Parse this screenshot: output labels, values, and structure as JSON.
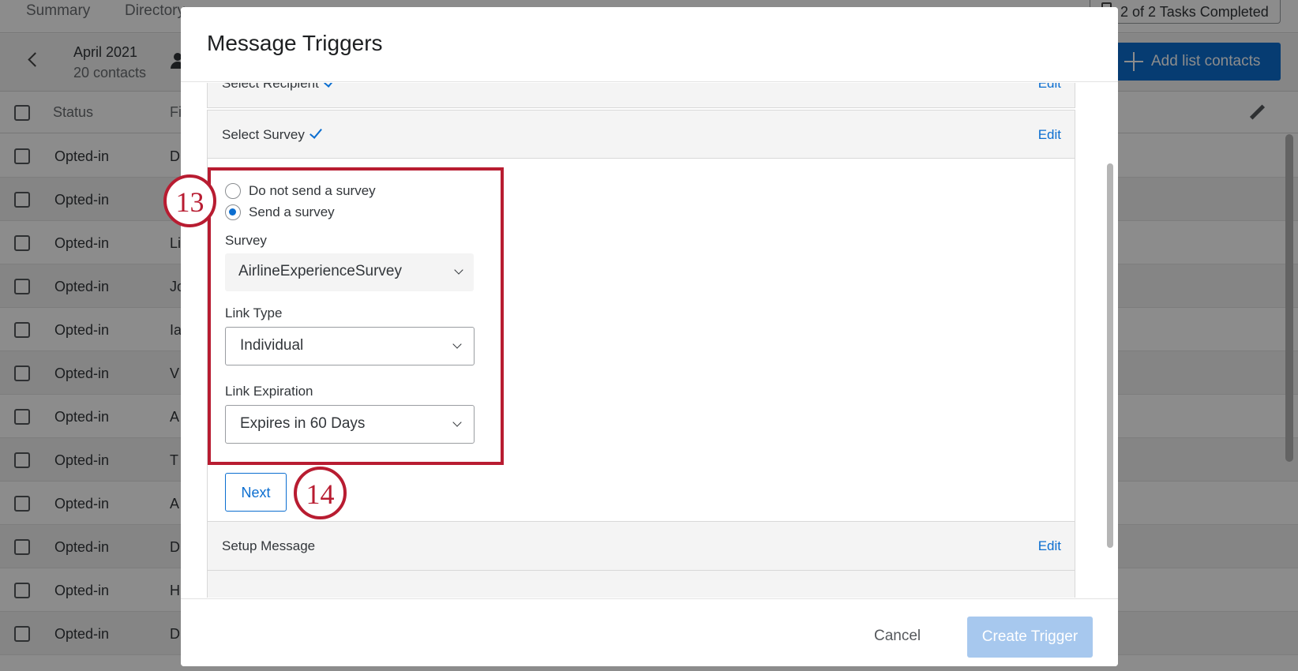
{
  "app": {
    "nav": [
      "Summary",
      "Directory"
    ],
    "tasks_label": "2 of 2 Tasks Completed",
    "list_name": "April 2021",
    "list_count": "20 contacts",
    "add_contacts_label": "Add list contacts",
    "columns": {
      "status": "Status",
      "first": "Fi"
    },
    "rows": [
      {
        "status": "Opted-in",
        "first": "D"
      },
      {
        "status": "Opted-in",
        "first": ""
      },
      {
        "status": "Opted-in",
        "first": "Li"
      },
      {
        "status": "Opted-in",
        "first": "Jo"
      },
      {
        "status": "Opted-in",
        "first": "Ia"
      },
      {
        "status": "Opted-in",
        "first": "V"
      },
      {
        "status": "Opted-in",
        "first": "A"
      },
      {
        "status": "Opted-in",
        "first": "T"
      },
      {
        "status": "Opted-in",
        "first": "A"
      },
      {
        "status": "Opted-in",
        "first": "D"
      },
      {
        "status": "Opted-in",
        "first": "H"
      },
      {
        "status": "Opted-in",
        "first": "D"
      }
    ]
  },
  "modal": {
    "title": "Message Triggers",
    "sections": {
      "recipient": {
        "label": "Select Recipient",
        "edit": "Edit"
      },
      "survey": {
        "label": "Select Survey",
        "edit": "Edit"
      },
      "message": {
        "label": "Setup Message",
        "edit": "Edit"
      }
    },
    "options": {
      "no_survey": "Do not send a survey",
      "send_survey": "Send a survey",
      "selected": "send_survey"
    },
    "fields": {
      "survey_label": "Survey",
      "survey_value": "AirlineExperienceSurvey",
      "link_type_label": "Link Type",
      "link_type_value": "Individual",
      "link_expiration_label": "Link Expiration",
      "link_expiration_value": "Expires in 60 Days"
    },
    "next_label": "Next",
    "cancel_label": "Cancel",
    "create_label": "Create Trigger"
  },
  "annotations": {
    "callout_13": "13",
    "callout_14": "14",
    "highlight_color": "#b81c31"
  },
  "colors": {
    "accent": "#0b6ed0",
    "disabled_button": "#a7c8ee"
  }
}
